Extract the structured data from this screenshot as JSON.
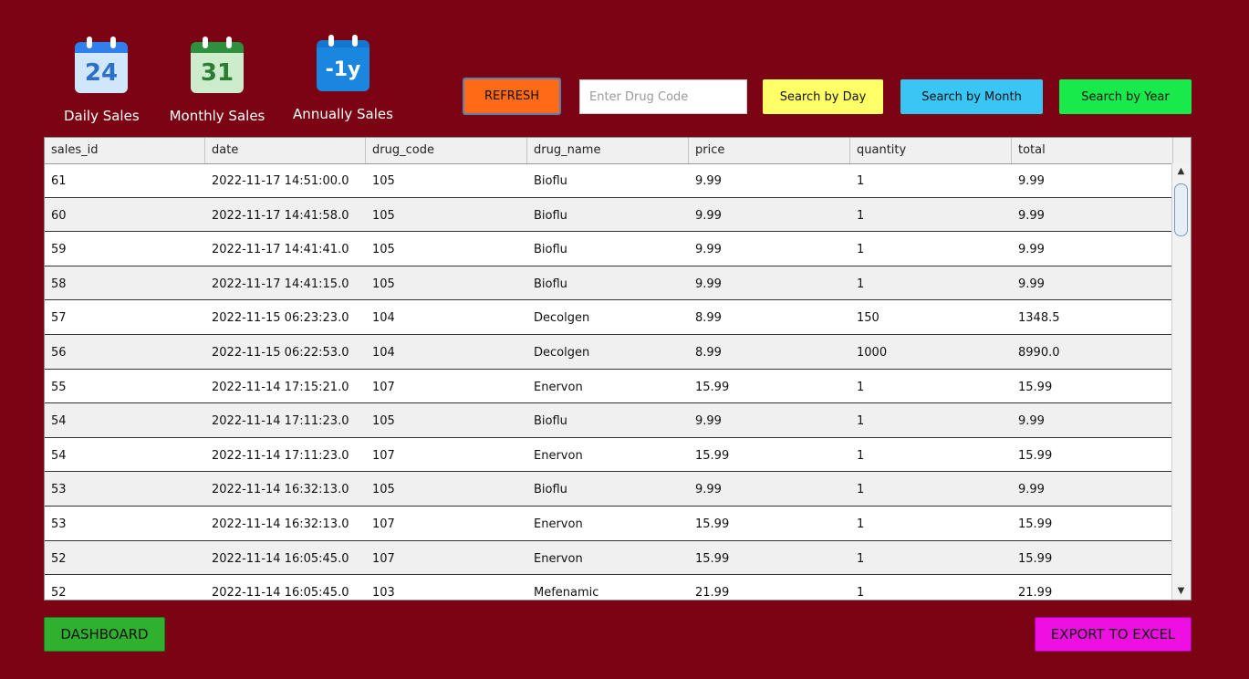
{
  "shortcuts": [
    {
      "label": "Daily Sales",
      "icon_text": "24",
      "icon": "calendar-day-icon"
    },
    {
      "label": "Monthly Sales",
      "icon_text": "31",
      "icon": "calendar-month-icon"
    },
    {
      "label": "Annually Sales",
      "icon_text": "-1y",
      "icon": "calendar-year-icon"
    }
  ],
  "toolbar": {
    "refresh_label": "REFRESH",
    "search_placeholder": "Enter Drug Code",
    "search_value": "",
    "by_day_label": "Search by Day",
    "by_month_label": "Search by Month",
    "by_year_label": "Search by Year"
  },
  "table": {
    "columns": [
      "sales_id",
      "date",
      "drug_code",
      "drug_name",
      "price",
      "quantity",
      "total"
    ],
    "rows": [
      [
        "61",
        "2022-11-17 14:51:00.0",
        "105",
        "Bioflu",
        "9.99",
        "1",
        "9.99"
      ],
      [
        "60",
        "2022-11-17 14:41:58.0",
        "105",
        "Bioflu",
        "9.99",
        "1",
        "9.99"
      ],
      [
        "59",
        "2022-11-17 14:41:41.0",
        "105",
        "Bioflu",
        "9.99",
        "1",
        "9.99"
      ],
      [
        "58",
        "2022-11-17 14:41:15.0",
        "105",
        "Bioflu",
        "9.99",
        "1",
        "9.99"
      ],
      [
        "57",
        "2022-11-15 06:23:23.0",
        "104",
        "Decolgen",
        "8.99",
        "150",
        "1348.5"
      ],
      [
        "56",
        "2022-11-15 06:22:53.0",
        "104",
        "Decolgen",
        "8.99",
        "1000",
        "8990.0"
      ],
      [
        "55",
        "2022-11-14 17:15:21.0",
        "107",
        "Enervon",
        "15.99",
        "1",
        "15.99"
      ],
      [
        "54",
        "2022-11-14 17:11:23.0",
        "105",
        "Bioflu",
        "9.99",
        "1",
        "9.99"
      ],
      [
        "54",
        "2022-11-14 17:11:23.0",
        "107",
        "Enervon",
        "15.99",
        "1",
        "15.99"
      ],
      [
        "53",
        "2022-11-14 16:32:13.0",
        "105",
        "Bioflu",
        "9.99",
        "1",
        "9.99"
      ],
      [
        "53",
        "2022-11-14 16:32:13.0",
        "107",
        "Enervon",
        "15.99",
        "1",
        "15.99"
      ],
      [
        "52",
        "2022-11-14 16:05:45.0",
        "107",
        "Enervon",
        "15.99",
        "1",
        "15.99"
      ],
      [
        "52",
        "2022-11-14 16:05:45.0",
        "103",
        "Mefenamic",
        "21.99",
        "1",
        "21.99"
      ]
    ]
  },
  "footer": {
    "dashboard_label": "DASHBOARD",
    "export_label": "EXPORT TO EXCEL"
  },
  "colors": {
    "background": "#7a0414",
    "refresh": "#ff6a17",
    "by_day": "#ffff66",
    "by_month": "#39c6f5",
    "by_year": "#18ea4c",
    "dashboard": "#2fb12f",
    "export": "#ee10e0"
  }
}
